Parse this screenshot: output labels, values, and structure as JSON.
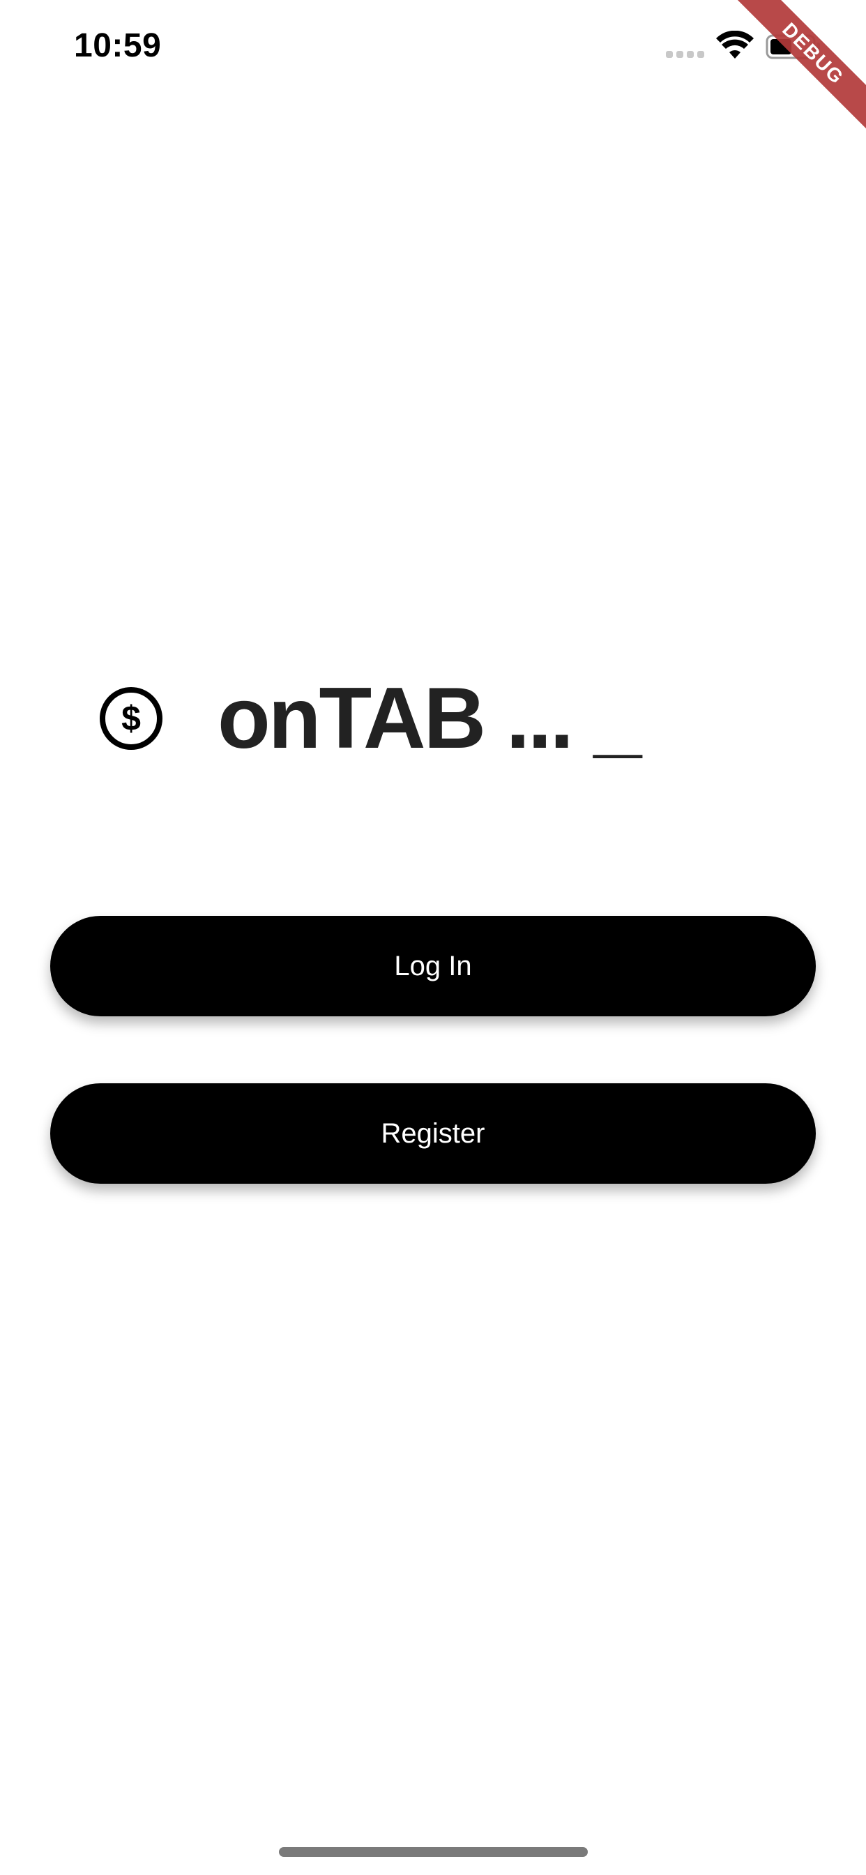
{
  "status_bar": {
    "time": "10:59",
    "icons": [
      "signal-dots-icon",
      "wifi-icon",
      "battery-icon"
    ]
  },
  "debug_banner": {
    "label": "DEBUG",
    "color": "#b33a3a"
  },
  "logo": {
    "icon": "dollar-circle-icon",
    "title": "onTAB ... _"
  },
  "actions": {
    "login_label": "Log In",
    "register_label": "Register"
  },
  "colors": {
    "background": "#ffffff",
    "button_bg": "#000000",
    "button_text": "#ffffff",
    "title_text": "#222222"
  }
}
